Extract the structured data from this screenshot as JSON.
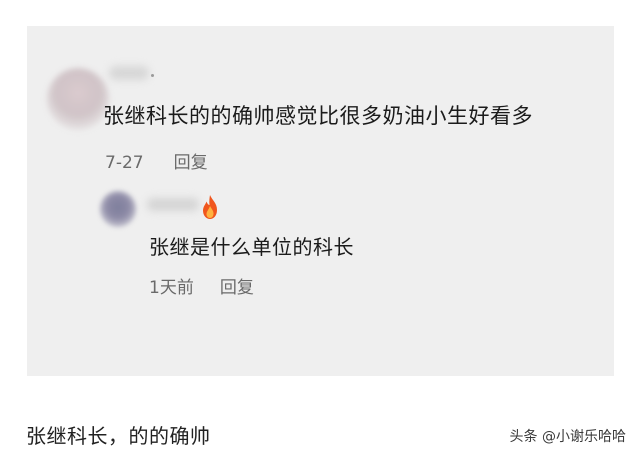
{
  "comment": {
    "text": "张继科长的的确帅感觉比很多奶油小生好看多",
    "date": "7-27",
    "reply_label": "回复"
  },
  "reply_comment": {
    "text": "张继是什么单位的科长",
    "time": "1天前",
    "reply_label": "回复"
  },
  "caption": "张继科长，的的确帅",
  "watermark": "头条 @小谢乐哈哈",
  "colors": {
    "panel_bg": "#efefef",
    "text": "#1b1b1b",
    "meta": "#6a6a6a"
  },
  "icons": [
    "fire-icon"
  ]
}
